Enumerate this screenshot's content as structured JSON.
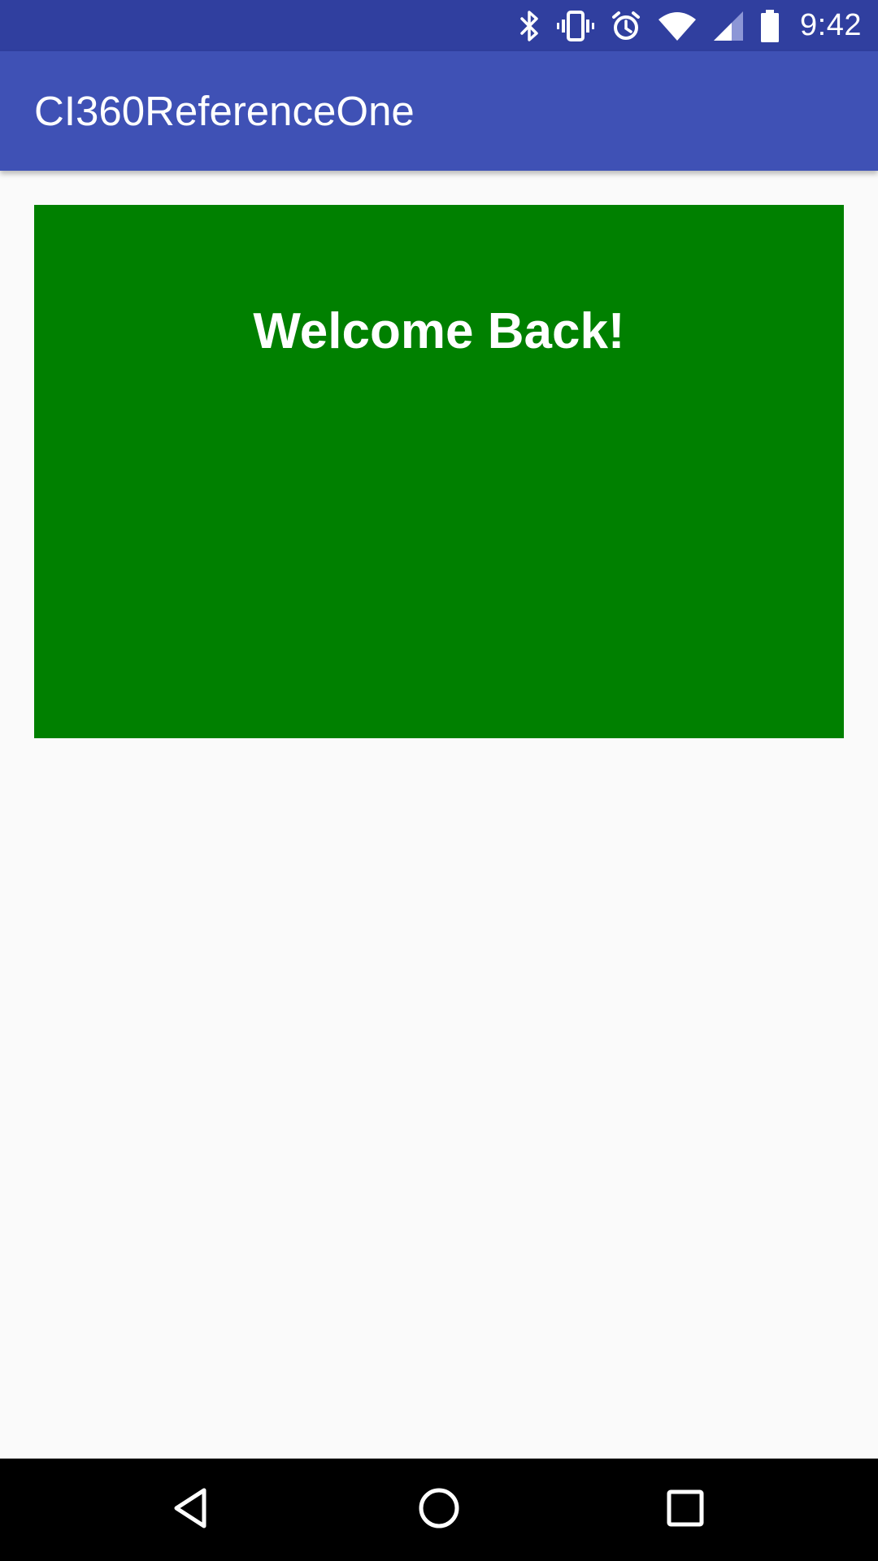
{
  "status_bar": {
    "time": "9:42",
    "icons": [
      "bluetooth-icon",
      "vibrate-icon",
      "alarm-icon",
      "wifi-icon",
      "cell-signal-icon",
      "battery-icon"
    ],
    "background": "#303f9f"
  },
  "app_bar": {
    "title": "CI360ReferenceOne",
    "background": "#3f51b5"
  },
  "main": {
    "welcome_text": "Welcome Back!",
    "card_color": "#008000"
  },
  "nav_bar": {
    "buttons": [
      "back-icon",
      "home-icon",
      "recents-icon"
    ]
  }
}
